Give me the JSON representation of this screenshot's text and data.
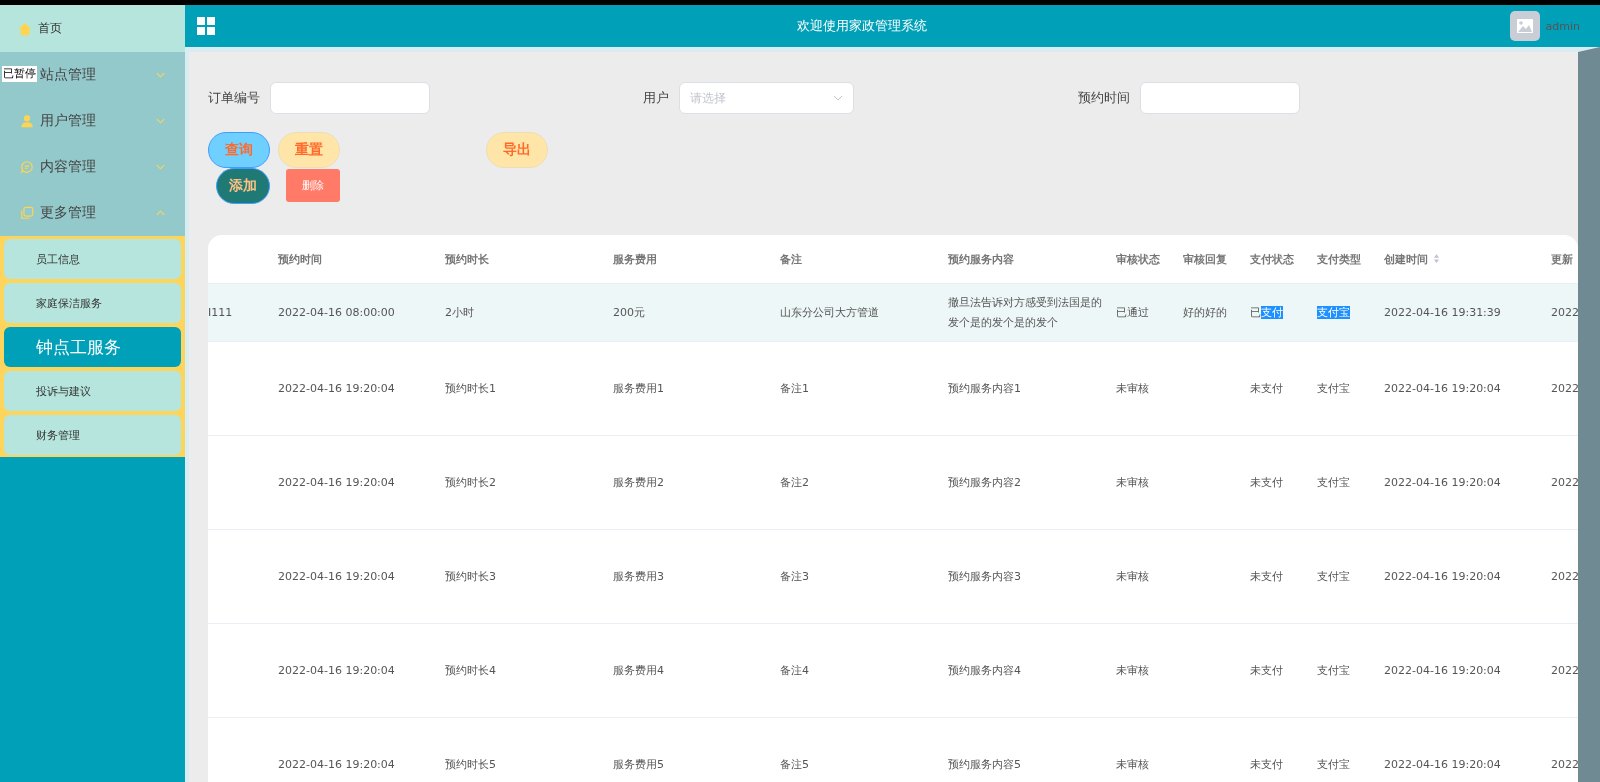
{
  "sidebar": {
    "home": {
      "label": "首页"
    },
    "overlay_label": "已暂停",
    "menus": [
      {
        "label": "站点管理",
        "expanded": false
      },
      {
        "label": "用户管理",
        "expanded": false
      },
      {
        "label": "内容管理",
        "expanded": false
      },
      {
        "label": "更多管理",
        "expanded": true
      }
    ],
    "submenu": [
      {
        "label": "员工信息",
        "selected": false
      },
      {
        "label": "家庭保洁服务",
        "selected": false
      },
      {
        "label": "钟点工服务",
        "selected": true
      },
      {
        "label": "投诉与建议",
        "selected": false
      },
      {
        "label": "财务管理",
        "selected": false
      }
    ]
  },
  "header": {
    "title": "欢迎使用家政管理系统",
    "user": "admin"
  },
  "filters": [
    {
      "label": "订单编号",
      "kind": "text"
    },
    {
      "label": "用户",
      "kind": "select",
      "placeholder": "请选择"
    },
    {
      "label": "预约时间",
      "kind": "text"
    }
  ],
  "buttons": [
    {
      "label": "查询",
      "kind": "query"
    },
    {
      "label": "重置",
      "kind": "reset"
    },
    {
      "label": "导出",
      "kind": "export"
    },
    {
      "label": "添加",
      "kind": "add"
    },
    {
      "label": "删除",
      "kind": "delete"
    }
  ],
  "table": {
    "columns": [
      "",
      "预约时间",
      "预约时长",
      "服务费用",
      "备注",
      "预约服务内容",
      "审核状态",
      "审核回复",
      "支付状态",
      "支付类型",
      "创建时间",
      "更新"
    ],
    "rows": [
      {
        "cells": [
          "I111",
          "2022-04-16 08:00:00",
          "2小时",
          "200元",
          "山东分公司大方管道",
          "撤旦法告诉对方感受到法国是的发个是的发个是的发个",
          "已通过",
          "好的好的",
          {
            "plain": "已",
            "highlighted": "支付"
          },
          {
            "highlighted": "支付宝"
          },
          "2022-04-16 19:31:39",
          "2022"
        ],
        "hovered": true
      },
      {
        "cells": [
          "",
          "2022-04-16 19:20:04",
          "预约时长1",
          "服务费用1",
          "备注1",
          "预约服务内容1",
          "未审核",
          "",
          "未支付",
          "支付宝",
          "2022-04-16 19:20:04",
          "2022"
        ],
        "hovered": false
      },
      {
        "cells": [
          "",
          "2022-04-16 19:20:04",
          "预约时长2",
          "服务费用2",
          "备注2",
          "预约服务内容2",
          "未审核",
          "",
          "未支付",
          "支付宝",
          "2022-04-16 19:20:04",
          "2022"
        ],
        "hovered": false
      },
      {
        "cells": [
          "",
          "2022-04-16 19:20:04",
          "预约时长3",
          "服务费用3",
          "备注3",
          "预约服务内容3",
          "未审核",
          "",
          "未支付",
          "支付宝",
          "2022-04-16 19:20:04",
          "2022"
        ],
        "hovered": false
      },
      {
        "cells": [
          "",
          "2022-04-16 19:20:04",
          "预约时长4",
          "服务费用4",
          "备注4",
          "预约服务内容4",
          "未审核",
          "",
          "未支付",
          "支付宝",
          "2022-04-16 19:20:04",
          "2022"
        ],
        "hovered": false
      },
      {
        "cells": [
          "",
          "2022-04-16 19:20:04",
          "预约时长5",
          "服务费用5",
          "备注5",
          "预约服务内容5",
          "未审核",
          "",
          "未支付",
          "支付宝",
          "2022-04-16 19:20:04",
          "2022"
        ],
        "hovered": false
      }
    ]
  }
}
